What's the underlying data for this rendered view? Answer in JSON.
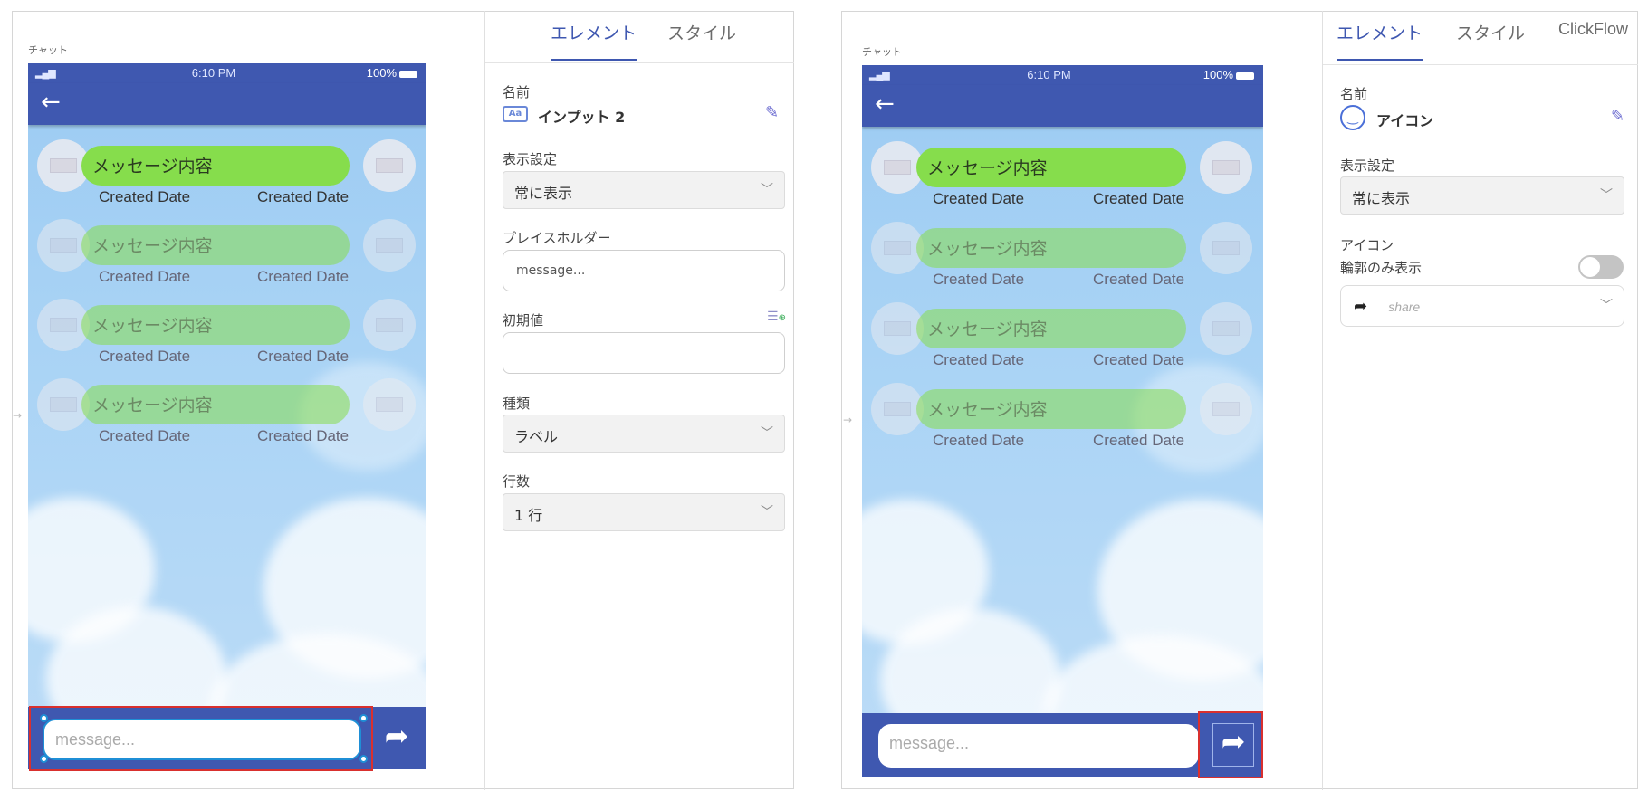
{
  "left": {
    "screen_label": "チャット",
    "status": {
      "time": "6:10 PM",
      "battery": "100%"
    },
    "rows": [
      {
        "message": "メッセージ内容",
        "date_left": "Created Date",
        "date_right": "Created Date"
      },
      {
        "message": "メッセージ内容",
        "date_left": "Created Date",
        "date_right": "Created Date"
      },
      {
        "message": "メッセージ内容",
        "date_left": "Created Date",
        "date_right": "Created Date"
      },
      {
        "message": "メッセージ内容",
        "date_left": "Created Date",
        "date_right": "Created Date"
      }
    ],
    "input_placeholder": "message..."
  },
  "left_inspector": {
    "tabs": [
      "エレメント",
      "スタイル"
    ],
    "name_label": "名前",
    "name_value": "インプット 2",
    "display_label": "表示設定",
    "display_value": "常に表示",
    "placeholder_label": "プレイスホルダー",
    "placeholder_value": "message...",
    "initial_label": "初期値",
    "initial_value": "",
    "type_label": "種類",
    "type_value": "ラベル",
    "lines_label": "行数",
    "lines_value": "1 行"
  },
  "right": {
    "screen_label": "チャット",
    "status": {
      "time": "6:10 PM",
      "battery": "100%"
    },
    "rows": [
      {
        "message": "メッセージ内容",
        "date_left": "Created Date",
        "date_right": "Created Date"
      },
      {
        "message": "メッセージ内容",
        "date_left": "Created Date",
        "date_right": "Created Date"
      },
      {
        "message": "メッセージ内容",
        "date_left": "Created Date",
        "date_right": "Created Date"
      },
      {
        "message": "メッセージ内容",
        "date_left": "Created Date",
        "date_right": "Created Date"
      }
    ],
    "input_placeholder": "message..."
  },
  "right_inspector": {
    "tabs": [
      "エレメント",
      "スタイル",
      "ClickFlow"
    ],
    "name_label": "名前",
    "name_value": "アイコン",
    "display_label": "表示設定",
    "display_value": "常に表示",
    "icon_label": "アイコン",
    "outline_label": "輪郭のみ表示",
    "icon_value": "share"
  },
  "icons": {
    "back": "arrow-left-icon",
    "send": "share-icon",
    "edit": "pencil-icon"
  },
  "colors": {
    "accent": "#3e57b0",
    "navbar": "#3f58b0",
    "bubble": "#86dd4c",
    "selection": "#d9302e"
  }
}
